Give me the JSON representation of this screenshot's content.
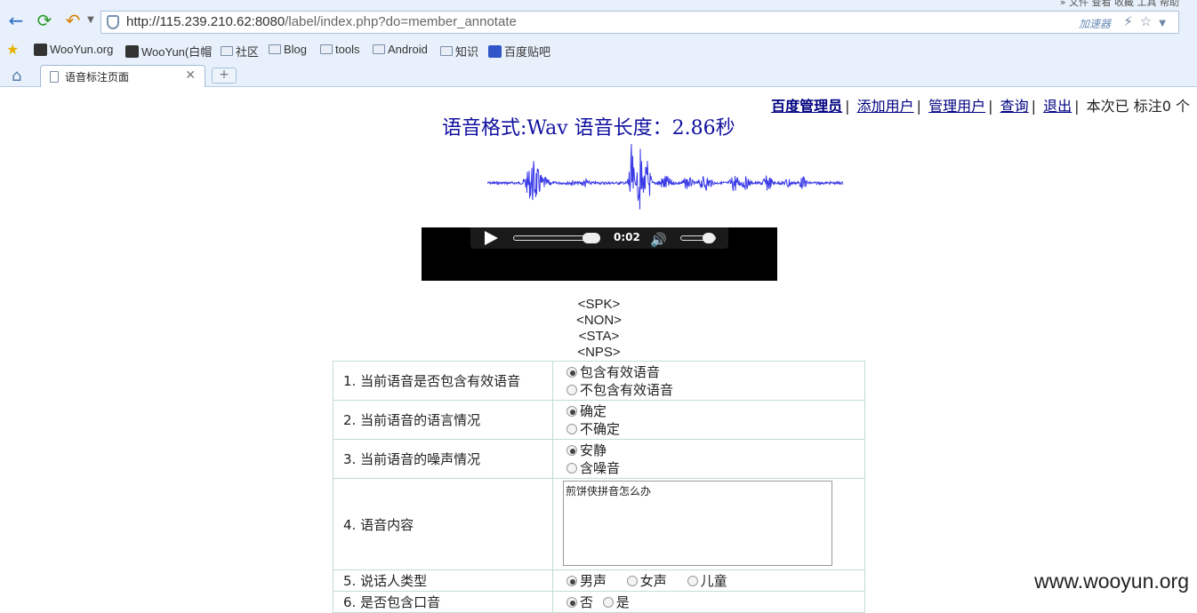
{
  "browser": {
    "top_menu": "» 文件  查看  收藏  工具  帮助",
    "url_host": "http://115.239.210.62:8080",
    "url_path": "/label/index.php?do=member_annotate",
    "accelerator": "加速器",
    "bookmarks": [
      {
        "label": "WooYun.org",
        "icon": "wooyun-icon"
      },
      {
        "label": "WooYun(白帽",
        "icon": "wooyun-icon"
      },
      {
        "label": "社区",
        "icon": "folder-icon"
      },
      {
        "label": "Blog",
        "icon": "folder-icon"
      },
      {
        "label": "tools",
        "icon": "folder-icon"
      },
      {
        "label": "Android",
        "icon": "folder-icon"
      },
      {
        "label": "知识",
        "icon": "folder-icon"
      },
      {
        "label": "百度贴吧",
        "icon": "baidu-paw-icon"
      }
    ],
    "tab_title": "语音标注页面",
    "colors": {
      "accent": "#2a6fc9",
      "chrome": "#e8f1fb"
    }
  },
  "header": {
    "user_link": "百度管理员",
    "add_user": "添加用户",
    "manage_users": "管理用户",
    "query": "查询",
    "logout": "退出",
    "status": "本次已 标注0 个"
  },
  "audio": {
    "heading": "语音格式:Wav 语音长度：2.86秒",
    "current_time": "0:02",
    "progress_fraction": 0.85
  },
  "tags": [
    "<SPK>",
    "<NON>",
    "<STA>",
    "<NPS>"
  ],
  "form": {
    "q1": {
      "label": "1. 当前语音是否包含有效语音",
      "options": [
        "包含有效语音",
        "不包含有效语音"
      ],
      "selected": 0
    },
    "q2": {
      "label": "2. 当前语音的语言情况",
      "options": [
        "确定",
        "不确定"
      ],
      "selected": 0
    },
    "q3": {
      "label": "3. 当前语音的噪声情况",
      "options": [
        "安静",
        "含噪音"
      ],
      "selected": 0
    },
    "q4": {
      "label": "4. 语音内容",
      "value": "煎饼侠拼音怎么办"
    },
    "q5": {
      "label": "5. 说话人类型",
      "options": [
        "男声",
        "女声",
        "儿童"
      ],
      "selected": 0
    },
    "q6": {
      "label": "6. 是否包含口音",
      "options": [
        "否",
        "是"
      ],
      "selected": 0
    }
  },
  "watermark": "www.wooyun.org"
}
